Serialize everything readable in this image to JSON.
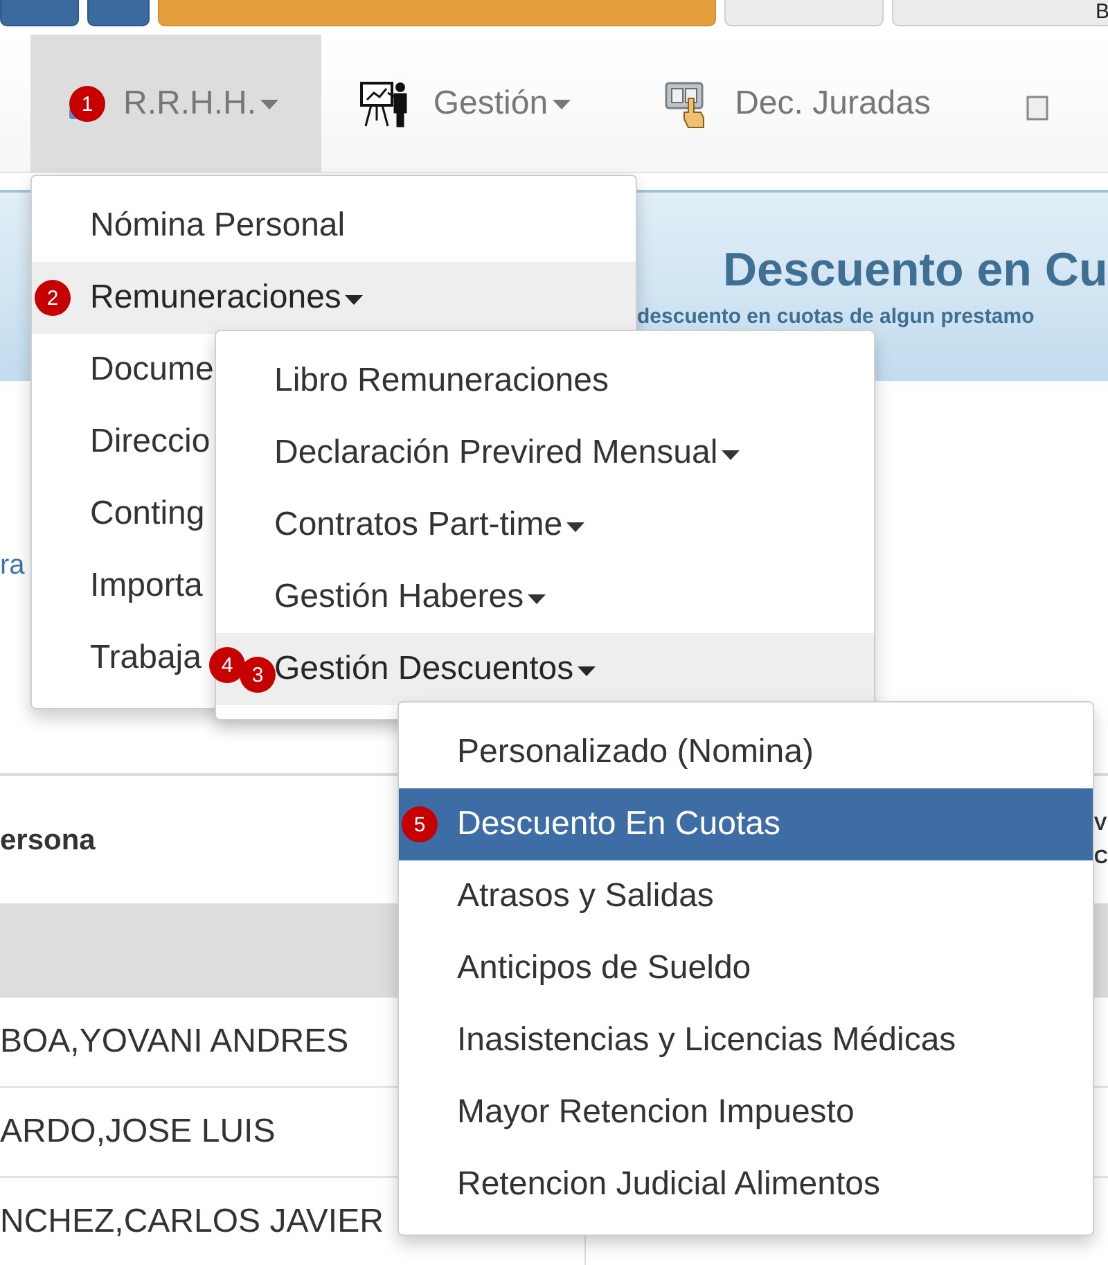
{
  "top_bar": {
    "buttons": [
      {
        "kind": "primary"
      },
      {
        "kind": "primary"
      },
      {
        "kind": "warning"
      },
      {
        "kind": "default"
      },
      {
        "kind": "default",
        "label": "B"
      }
    ]
  },
  "nav": {
    "tabs": [
      {
        "label": "R.R.H.H.",
        "selected": true,
        "dropdown": true,
        "markers": [
          "1"
        ],
        "menu": {
          "items": [
            {
              "label": "Nómina Personal",
              "selected": false
            },
            {
              "label": "Remuneraciones",
              "selected": true,
              "dropdown": true,
              "markers": [
                "2"
              ],
              "submenu": {
                "items": [
                  {
                    "label": "Libro Remuneraciones",
                    "selected": false
                  },
                  {
                    "label": "Declaración Previred Mensual",
                    "selected": false,
                    "dropdown": true
                  },
                  {
                    "label": "Contratos Part-time",
                    "selected": false,
                    "dropdown": true
                  },
                  {
                    "label": "Gestión Haberes",
                    "selected": false,
                    "dropdown": true
                  },
                  {
                    "label": "Gestión Descuentos",
                    "selected": true,
                    "dropdown": true,
                    "markers": [
                      "4",
                      "3"
                    ],
                    "submenu": {
                      "items": [
                        {
                          "label": "Personalizado (Nomina)",
                          "selected": false
                        },
                        {
                          "label": "Descuento En Cuotas",
                          "selected": true,
                          "markers": [
                            "5"
                          ]
                        },
                        {
                          "label": "Atrasos y Salidas",
                          "selected": false
                        },
                        {
                          "label": "Anticipos de Sueldo",
                          "selected": false
                        },
                        {
                          "label": "Inasistencias y Licencias Médicas",
                          "selected": false
                        },
                        {
                          "label": "Mayor Retencion Impuesto",
                          "selected": false
                        },
                        {
                          "label": "Retencion Judicial Alimentos",
                          "selected": false
                        }
                      ]
                    }
                  }
                ]
              }
            },
            {
              "label": "Docume",
              "selected": false
            },
            {
              "label": "Direccio",
              "selected": false
            },
            {
              "label": "Conting",
              "selected": false
            },
            {
              "label": "Importa",
              "selected": false
            },
            {
              "label": "Trabaja",
              "selected": false
            }
          ]
        }
      },
      {
        "label": "Gestión",
        "selected": false,
        "dropdown": true
      },
      {
        "label": "Dec. Juradas",
        "selected": false,
        "dropdown": false
      },
      {
        "selected": false
      }
    ]
  },
  "banner": {
    "title": "Descuento en Cu",
    "subtitle": "descuento en cuotas de algun prestamo"
  },
  "link_fragment": "ra",
  "table": {
    "columns": [
      {
        "lines": [
          "ersona"
        ]
      },
      {
        "lines": [
          "V",
          "C"
        ]
      }
    ],
    "rows": [
      [
        "BOA,YOVANI ANDRES"
      ],
      [
        "ARDO,JOSE LUIS"
      ],
      [
        "NCHEZ,CARLOS JAVIER"
      ]
    ]
  }
}
